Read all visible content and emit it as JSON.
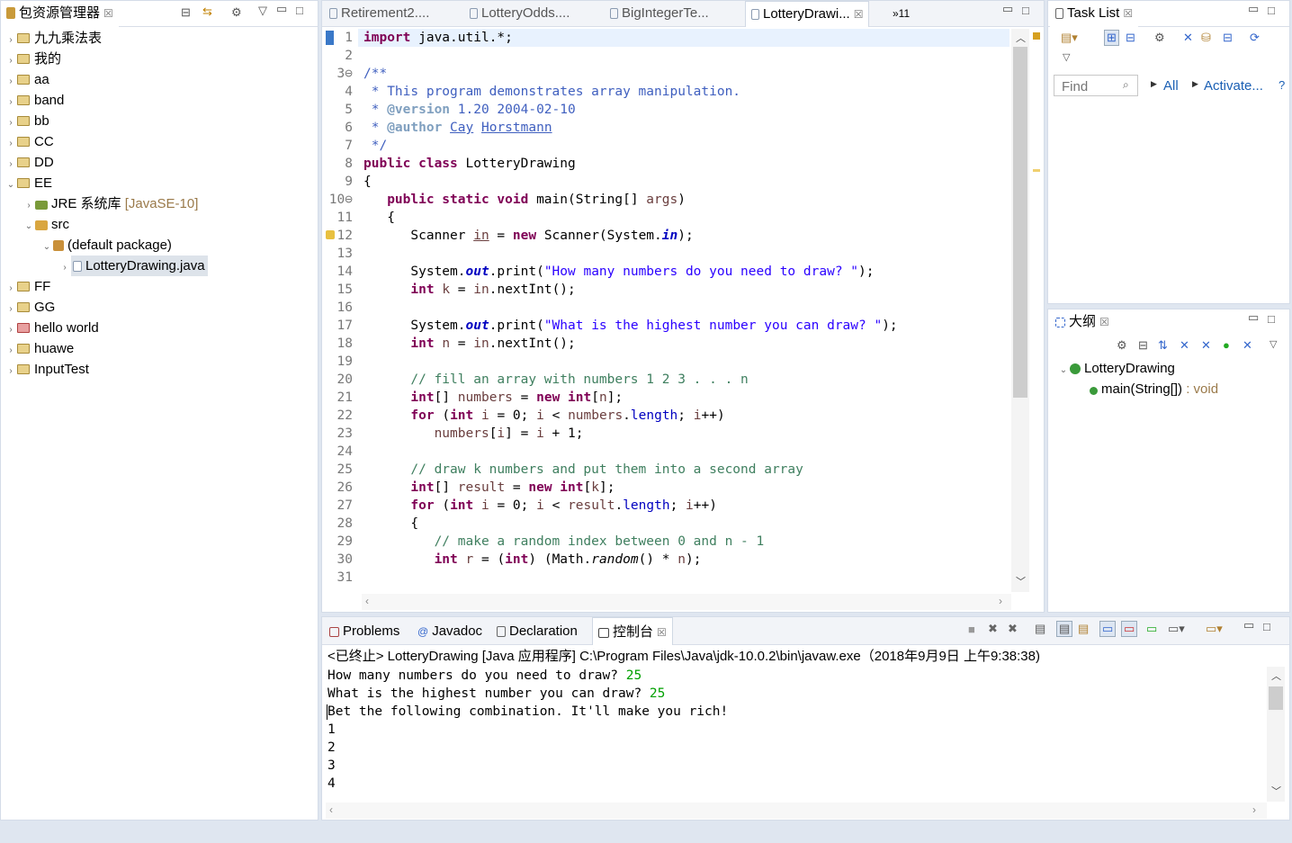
{
  "package_explorer": {
    "title": "包资源管理器",
    "items": [
      {
        "label": "九九乘法表",
        "level": 0,
        "expanded": false
      },
      {
        "label": "我的",
        "level": 0,
        "expanded": false
      },
      {
        "label": "aa",
        "level": 0,
        "expanded": false
      },
      {
        "label": "band",
        "level": 0,
        "expanded": false
      },
      {
        "label": "bb",
        "level": 0,
        "expanded": false
      },
      {
        "label": "CC",
        "level": 0,
        "expanded": false
      },
      {
        "label": "DD",
        "level": 0,
        "expanded": false
      },
      {
        "label": "EE",
        "level": 0,
        "expanded": true
      },
      {
        "label": "JRE 系统库",
        "suffix": "[JavaSE-10]",
        "level": 1,
        "expanded": false
      },
      {
        "label": "src",
        "level": 1,
        "expanded": true
      },
      {
        "label": "(default package)",
        "level": 2,
        "expanded": true
      },
      {
        "label": "LotteryDrawing.java",
        "level": 3,
        "expanded": false,
        "selected": true
      },
      {
        "label": "FF",
        "level": 0,
        "expanded": false
      },
      {
        "label": "GG",
        "level": 0,
        "expanded": false
      },
      {
        "label": "hello world",
        "level": 0,
        "expanded": false
      },
      {
        "label": "huawe",
        "level": 0,
        "expanded": false
      },
      {
        "label": "InputTest",
        "level": 0,
        "expanded": false
      }
    ]
  },
  "editor": {
    "tabs": [
      {
        "label": "Retirement2...."
      },
      {
        "label": "LotteryOdds...."
      },
      {
        "label": "BigIntegerTe..."
      },
      {
        "label": "LotteryDrawi...",
        "active": true
      }
    ],
    "overflow_label": "»11",
    "lines": [
      "1",
      "2",
      "3⊖",
      "4",
      "5",
      "6",
      "7",
      "8",
      "9",
      "10⊖",
      "11",
      "12",
      "13",
      "14",
      "15",
      "16",
      "17",
      "18",
      "19",
      "20",
      "21",
      "22",
      "23",
      "24",
      "25",
      "26",
      "27",
      "28",
      "29",
      "30",
      "31"
    ]
  },
  "task_list": {
    "title": "Task List",
    "find_placeholder": "Find",
    "all_label": "All",
    "activate_label": "Activate..."
  },
  "outline": {
    "title": "大纲",
    "class_name": "LotteryDrawing",
    "method_name": "main(String[])",
    "method_return": " : void"
  },
  "bottom_tabs": {
    "problems": "Problems",
    "javadoc": "Javadoc",
    "declaration": "Declaration",
    "console": "控制台"
  },
  "console": {
    "header": "<已终止> LotteryDrawing [Java 应用程序] C:\\Program Files\\Java\\jdk-10.0.2\\bin\\javaw.exe（2018年9月9日 上午9:38:38)",
    "prompt1": "How many numbers do you need to draw? ",
    "input1": "25",
    "prompt2": "What is the highest number you can draw? ",
    "input2": "25",
    "line3": "Bet the following combination. It'll make you rich!",
    "numbers": [
      "1",
      "2",
      "3",
      "4"
    ]
  }
}
